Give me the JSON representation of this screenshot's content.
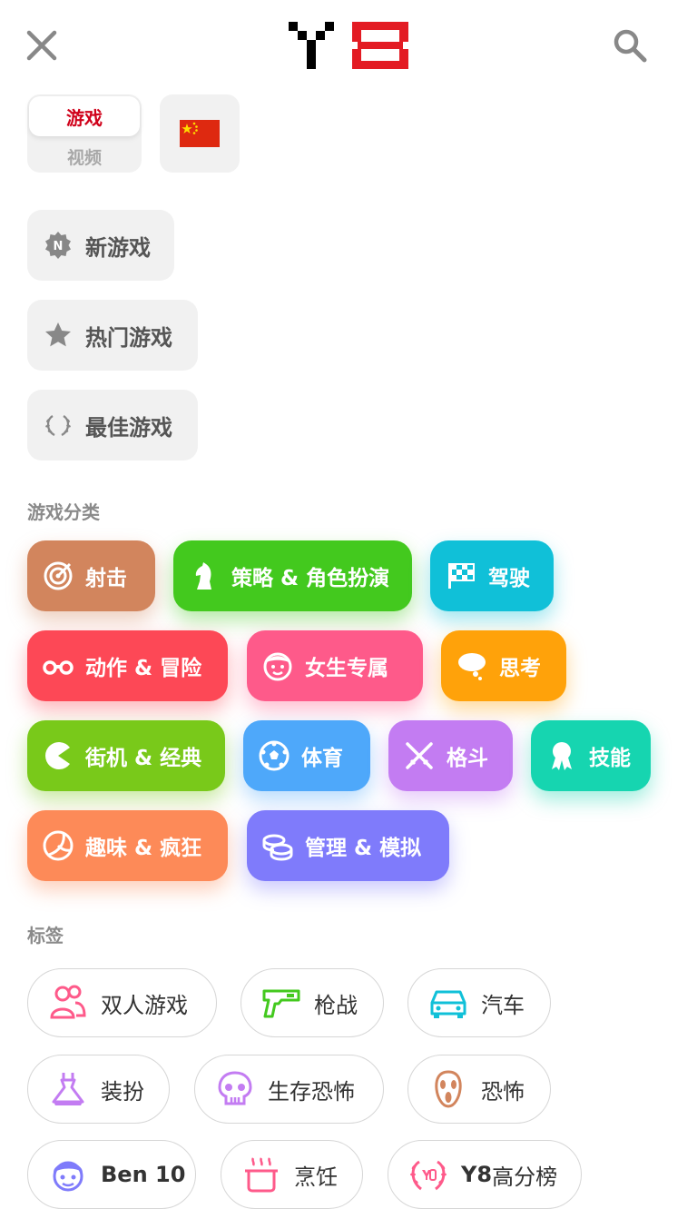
{
  "header": {
    "close_icon": "close-icon",
    "logo_text": "Y8",
    "search_icon": "search-icon"
  },
  "switcher": {
    "active": "游戏",
    "inactive": "视频",
    "language_flag": "china-flag-icon"
  },
  "nav": {
    "new_games": "新游戏",
    "hot_games": "热门游戏",
    "best_games": "最佳游戏"
  },
  "categories_title": "游戏分类",
  "categories": [
    {
      "label": "射击",
      "color": "#d2855d",
      "icon": "target-icon"
    },
    {
      "label": "策略 & 角色扮演",
      "color": "#43c91e",
      "icon": "chess-knight-icon"
    },
    {
      "label": "驾驶",
      "color": "#10c0d8",
      "icon": "checkered-flag-icon"
    },
    {
      "label": "动作 & 冒险",
      "color": "#fd4856",
      "icon": "binoculars-icon"
    },
    {
      "label": "女生专属",
      "color": "#fe5a8a",
      "icon": "girl-face-icon"
    },
    {
      "label": "思考",
      "color": "#ffa20a",
      "icon": "thought-bubble-icon"
    },
    {
      "label": "街机 & 经典",
      "color": "#79c91a",
      "icon": "pacman-icon"
    },
    {
      "label": "体育",
      "color": "#4ea8fa",
      "icon": "soccer-ball-icon"
    },
    {
      "label": "格斗",
      "color": "#c37cf2",
      "icon": "crossed-swords-icon"
    },
    {
      "label": "技能",
      "color": "#16d5b0",
      "icon": "award-ribbon-icon"
    },
    {
      "label": "趣味 & 疯狂",
      "color": "#fd8a58",
      "icon": "beach-ball-icon"
    },
    {
      "label": "管理 & 模拟",
      "color": "#7f7bfb",
      "icon": "coins-icon"
    }
  ],
  "tags_title": "标签",
  "tags": [
    {
      "label": "双人游戏",
      "icon": "two-players-icon",
      "color": "#fe5a8a"
    },
    {
      "label": "枪战",
      "icon": "pistol-icon",
      "color": "#43c91e"
    },
    {
      "label": "汽车",
      "icon": "car-icon",
      "color": "#10c0d8"
    },
    {
      "label": "装扮",
      "icon": "dress-icon",
      "color": "#c37cf2"
    },
    {
      "label": "生存恐怖",
      "icon": "skull-icon",
      "color": "#c37cf2"
    },
    {
      "label": "恐怖",
      "icon": "scream-mask-icon",
      "color": "#d2855d"
    },
    {
      "label_bold": "Ben 10",
      "label": "",
      "icon": "boy-face-icon",
      "color": "#7f7bfb"
    },
    {
      "label": "烹饪",
      "icon": "cooking-pot-icon",
      "color": "#fe5a8a"
    },
    {
      "label_bold": "Y8",
      "label": "高分榜",
      "icon": "trophy-laurel-icon",
      "color": "#fe5a8a"
    }
  ]
}
